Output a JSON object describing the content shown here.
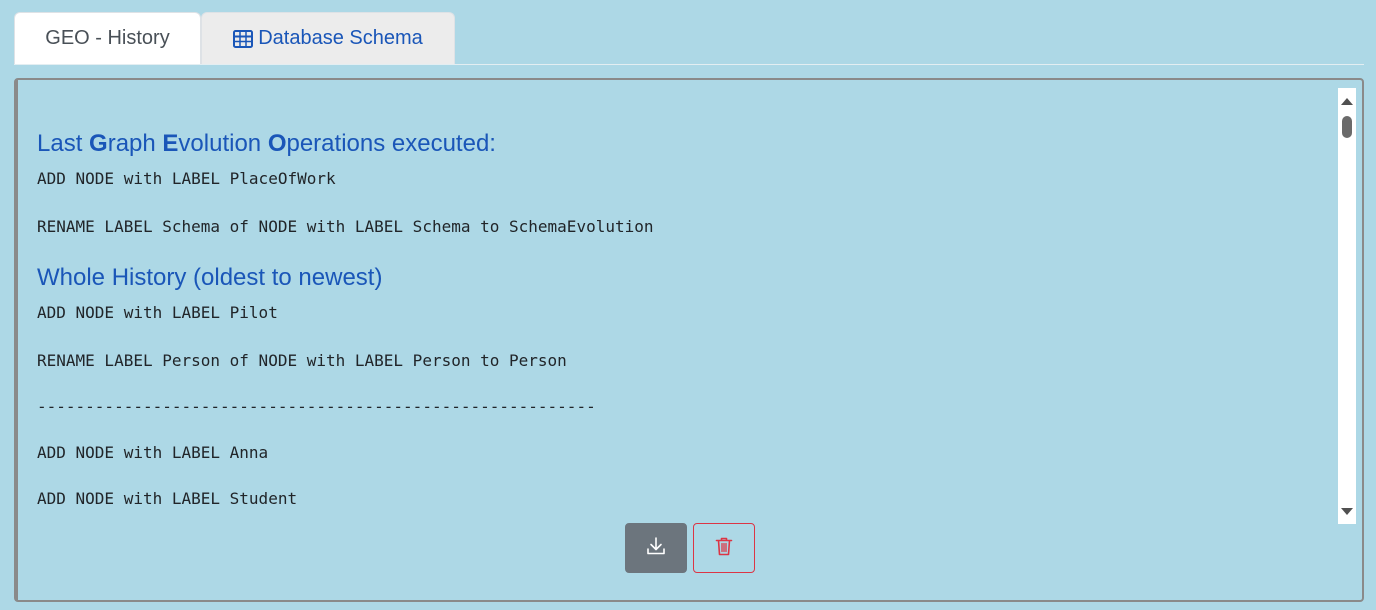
{
  "tabs": [
    {
      "label": "GEO - History",
      "active": true
    },
    {
      "label": "Database Schema",
      "icon": "table-icon",
      "active": false
    }
  ],
  "history_panel": {
    "last_ops_heading_parts": [
      "Last ",
      "G",
      "raph ",
      "E",
      "volution ",
      "O",
      "perations executed:"
    ],
    "last_operations": [
      "ADD NODE with LABEL PlaceOfWork",
      "RENAME LABEL Schema of NODE with LABEL Schema to SchemaEvolution"
    ],
    "whole_history_heading": "Whole History (oldest to newest)",
    "whole_history": [
      "ADD NODE with LABEL Pilot",
      "RENAME LABEL Person of NODE with LABEL Person to Person",
      "----------------------------------------------------------",
      "ADD NODE with LABEL Anna",
      "ADD NODE with LABEL Student"
    ]
  },
  "actions": {
    "download_icon": "download-icon",
    "delete_icon": "trash-icon"
  },
  "colors": {
    "background": "#add8e6",
    "heading": "#1a56b8",
    "download_button": "#6c757d",
    "delete_outline": "#dc3545"
  }
}
